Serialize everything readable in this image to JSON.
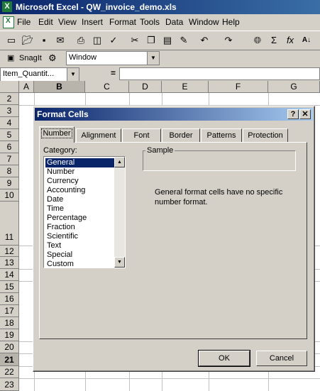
{
  "window": {
    "title": "Microsoft Excel - QW_invoice_demo.xls"
  },
  "menu": [
    "File",
    "Edit",
    "View",
    "Insert",
    "Format",
    "Tools",
    "Data",
    "Window",
    "Help"
  ],
  "toolbar": {
    "snagit_label": "SnagIt",
    "window_combo": "Window",
    "icons": [
      "new-icon",
      "open-icon",
      "save-icon",
      "email-icon",
      "print-icon",
      "print-preview-icon",
      "spelling-icon",
      "cut-icon",
      "copy-icon",
      "paste-icon",
      "format-painter-icon",
      "undo-icon",
      "redo-icon",
      "hyperlink-icon",
      "autosum-icon",
      "function-icon",
      "sort-ascending-icon"
    ]
  },
  "formula_bar": {
    "name_box": "Item_Quantit...",
    "equals": "="
  },
  "sheet": {
    "columns": [
      "A",
      "B",
      "C",
      "D",
      "E",
      "F",
      "G"
    ],
    "rows": [
      "2",
      "3",
      "4",
      "5",
      "6",
      "7",
      "8",
      "9",
      "10",
      "11",
      "12",
      "13",
      "14",
      "15",
      "16",
      "17",
      "18",
      "19",
      "20",
      "21",
      "22",
      "23"
    ],
    "active_row": "21"
  },
  "dialog": {
    "title": "Format Cells",
    "help_button": "?",
    "close_button": "✕",
    "tabs": [
      "Number",
      "Alignment",
      "Font",
      "Border",
      "Patterns",
      "Protection"
    ],
    "active_tab": "Number",
    "category_label": "Category:",
    "categories": [
      "General",
      "Number",
      "Currency",
      "Accounting",
      "Date",
      "Time",
      "Percentage",
      "Fraction",
      "Scientific",
      "Text",
      "Special",
      "Custom"
    ],
    "selected_category": "General",
    "sample_label": "Sample",
    "description": "General format cells have no specific number format.",
    "ok_label": "OK",
    "cancel_label": "Cancel"
  },
  "colors": {
    "title_bar": "#0a246a",
    "selection": "#0a246a",
    "face": "#d4d0c8"
  }
}
